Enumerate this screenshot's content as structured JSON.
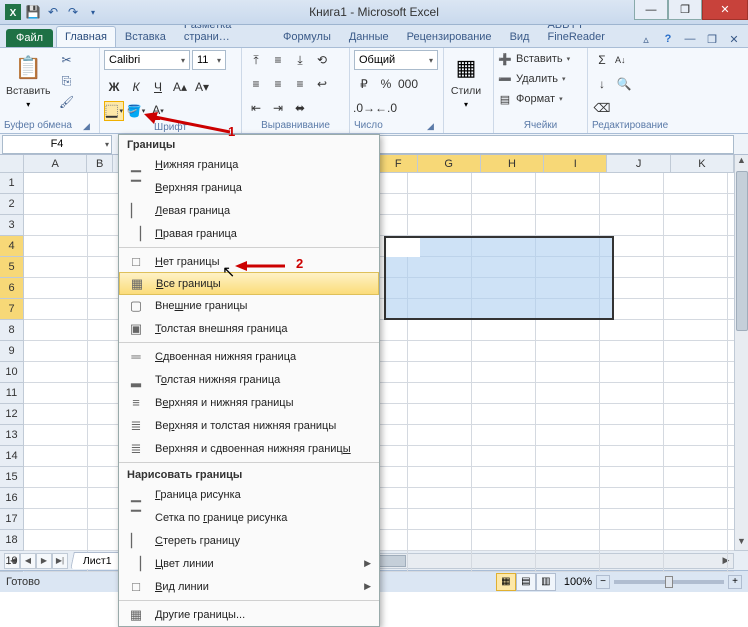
{
  "window": {
    "title": "Книга1 - Microsoft Excel"
  },
  "qat": {
    "save_icon": "save-icon",
    "undo_icon": "undo-icon",
    "redo_icon": "redo-icon",
    "customize_icon": "chevron-down-icon"
  },
  "tabs": {
    "file": "Файл",
    "items": [
      "Главная",
      "Вставка",
      "Разметка страни…",
      "Формулы",
      "Данные",
      "Рецензирование",
      "Вид",
      "ABBYY FineReader"
    ],
    "active_index": 0,
    "help_minimize": "▴",
    "help_icon": "?"
  },
  "ribbon": {
    "clipboard": {
      "label": "Буфер обмена",
      "paste": "Вставить"
    },
    "font": {
      "label": "Шрифт",
      "name": "Calibri",
      "size": "11",
      "bold": "Ж",
      "italic": "К",
      "underline": "Ч"
    },
    "alignment": {
      "label": "Выравнивание"
    },
    "number": {
      "label": "Число",
      "format": "Общий"
    },
    "styles": {
      "label": "Стили",
      "btn": "Стили"
    },
    "cells": {
      "label": "Ячейки",
      "insert": "Вставить",
      "delete": "Удалить",
      "format": "Формат"
    },
    "editing": {
      "label": "Редактирование"
    }
  },
  "borders_menu": {
    "title": "Границы",
    "items": [
      {
        "label": "Нижняя граница",
        "key": "Н"
      },
      {
        "label": "Верхняя граница",
        "key": "В"
      },
      {
        "label": "Левая граница",
        "key": "Л"
      },
      {
        "label": "Правая граница",
        "key": "П"
      }
    ],
    "items2": [
      {
        "label": "Нет границы",
        "key": "Н"
      },
      {
        "label": "Все границы",
        "key": "В",
        "highlight": true
      },
      {
        "label": "Внешние границы",
        "key": "ш"
      },
      {
        "label": "Толстая внешняя граница",
        "key": "Т"
      }
    ],
    "items3": [
      {
        "label": "Сдвоенная нижняя граница",
        "key": "С"
      },
      {
        "label": "Толстая нижняя граница",
        "key": "о"
      },
      {
        "label": "Верхняя и нижняя границы",
        "key": "е"
      },
      {
        "label": "Верхняя и толстая нижняя границы",
        "key": "р"
      },
      {
        "label": "Верхняя и сдвоенная нижняя границы",
        "key": "ы"
      }
    ],
    "draw_title": "Нарисовать границы",
    "items4": [
      {
        "label": "Граница рисунка",
        "key": "Г"
      },
      {
        "label": "Сетка по границе рисунка",
        "key": "г"
      },
      {
        "label": "Стереть границу",
        "key": "С"
      },
      {
        "label": "Цвет линии",
        "key": "Ц",
        "submenu": true
      },
      {
        "label": "Вид линии",
        "key": "В",
        "submenu": true
      }
    ],
    "items5": [
      {
        "label": "Другие границы...",
        "key": "Д"
      }
    ]
  },
  "annotations": {
    "label1": "1",
    "label2": "2"
  },
  "namebox": "F4",
  "selection": {
    "range": "F4:I7",
    "active": "F4"
  },
  "columns": [
    "A",
    "B",
    "F",
    "G",
    "H",
    "I",
    "J",
    "K"
  ],
  "selected_cols": [
    "F",
    "G",
    "H",
    "I"
  ],
  "rows_visible": 19,
  "selected_rows": [
    4,
    5,
    6,
    7
  ],
  "sheets": {
    "active": "Лист1"
  },
  "status": {
    "text": "Готово",
    "zoom": "100%"
  },
  "win": {
    "min": "—",
    "max": "❐",
    "close": "✕",
    "child_min": "—",
    "child_restore": "❐",
    "child_close": "✕"
  }
}
